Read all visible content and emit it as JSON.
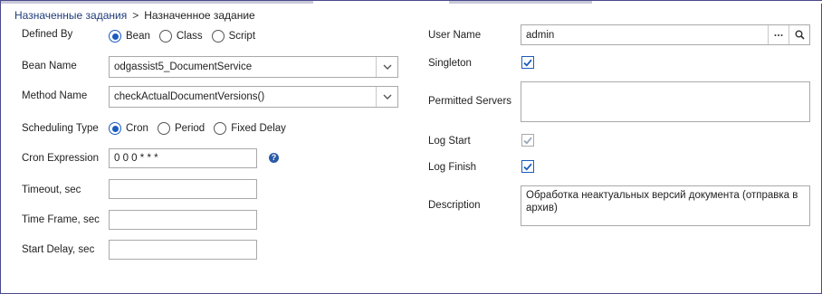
{
  "breadcrumb": {
    "parent": "Назначенные задания",
    "separator": ">",
    "current": "Назначенное задание"
  },
  "form": {
    "defined_by": {
      "label": "Defined By",
      "options": [
        "Bean",
        "Class",
        "Script"
      ],
      "selected": "Bean"
    },
    "bean_name": {
      "label": "Bean Name",
      "value": "odgassist5_DocumentService"
    },
    "method_name": {
      "label": "Method Name",
      "value": "checkActualDocumentVersions()"
    },
    "scheduling_type": {
      "label": "Scheduling Type",
      "options": [
        "Cron",
        "Period",
        "Fixed Delay"
      ],
      "selected": "Cron"
    },
    "cron_expression": {
      "label": "Cron Expression",
      "value": "0 0 0 * * *",
      "help_icon": "question-circle-icon"
    },
    "timeout": {
      "label": "Timeout, sec",
      "value": ""
    },
    "time_frame": {
      "label": "Time Frame, sec",
      "value": ""
    },
    "start_delay": {
      "label": "Start Delay, sec",
      "value": ""
    },
    "user_name": {
      "label": "User Name",
      "value": "admin",
      "lookup_icon": "ellipsis-icon",
      "search_icon": "search-icon"
    },
    "singleton": {
      "label": "Singleton",
      "checked": true
    },
    "permitted_servers": {
      "label": "Permitted Servers",
      "value": ""
    },
    "log_start": {
      "label": "Log Start",
      "checked": true,
      "disabled": true
    },
    "log_finish": {
      "label": "Log Finish",
      "checked": true
    },
    "description": {
      "label": "Description",
      "value": "Обработка неактуальных  версий документа (отправка в архив)"
    }
  },
  "colors": {
    "accent": "#1a5bbf",
    "link": "#1f3d7a",
    "frame": "#4a4a8c"
  }
}
